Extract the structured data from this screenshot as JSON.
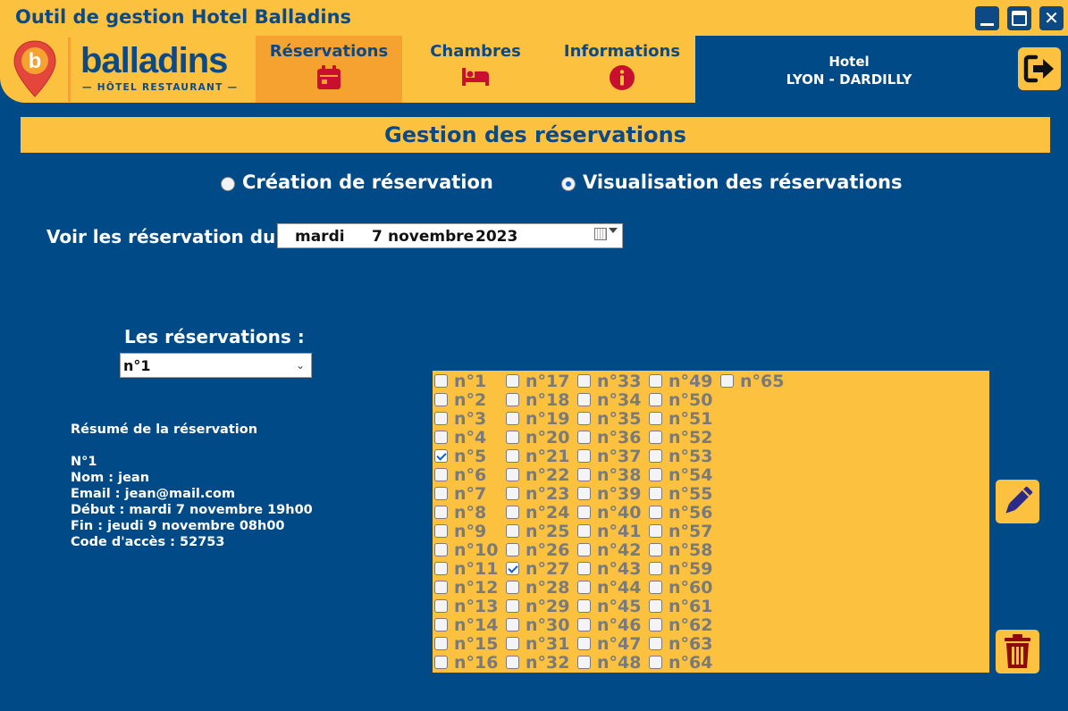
{
  "window": {
    "title": "Outil de gestion Hotel Balladins",
    "close_glyph": "✕"
  },
  "logo": {
    "name": "balladins",
    "subtitle": "— HÔTEL RESTAURANT —"
  },
  "tabs": [
    {
      "label": "Réservations",
      "icon": "calendar-icon",
      "active": true
    },
    {
      "label": "Chambres",
      "icon": "bed-icon",
      "active": false
    },
    {
      "label": "Informations",
      "icon": "info-icon",
      "active": false
    }
  ],
  "hotel": {
    "label": "Hotel",
    "name": "LYON - DARDILLY"
  },
  "banner": {
    "title": "Gestion des réservations"
  },
  "mode": {
    "create_label": "Création de réservation",
    "view_label": "Visualisation des réservations",
    "selected": "view"
  },
  "date_filter": {
    "label": "Voir les réservation du",
    "weekday": "mardi",
    "day": "7",
    "month": "novembre",
    "year": "2023"
  },
  "reservations": {
    "label": "Les réservations :",
    "selected": "n°1"
  },
  "summary": {
    "title": "Résumé de la réservation",
    "number": "N°1",
    "name": "Nom : jean",
    "email": "Email : jean@mail.com",
    "start": "Début : mardi 7 novembre 19h00",
    "end": "Fin : jeudi 9 novembre 08h00",
    "code": "Code d'accès : 52753"
  },
  "rooms": {
    "prefix": "n°",
    "count": 65,
    "checked": [
      5,
      27
    ]
  },
  "colors": {
    "background": "#004a87",
    "yellow": "#fcc23f",
    "orange": "#f6a230",
    "navy_text": "#0d4a85",
    "icon_red": "#c8102e"
  }
}
